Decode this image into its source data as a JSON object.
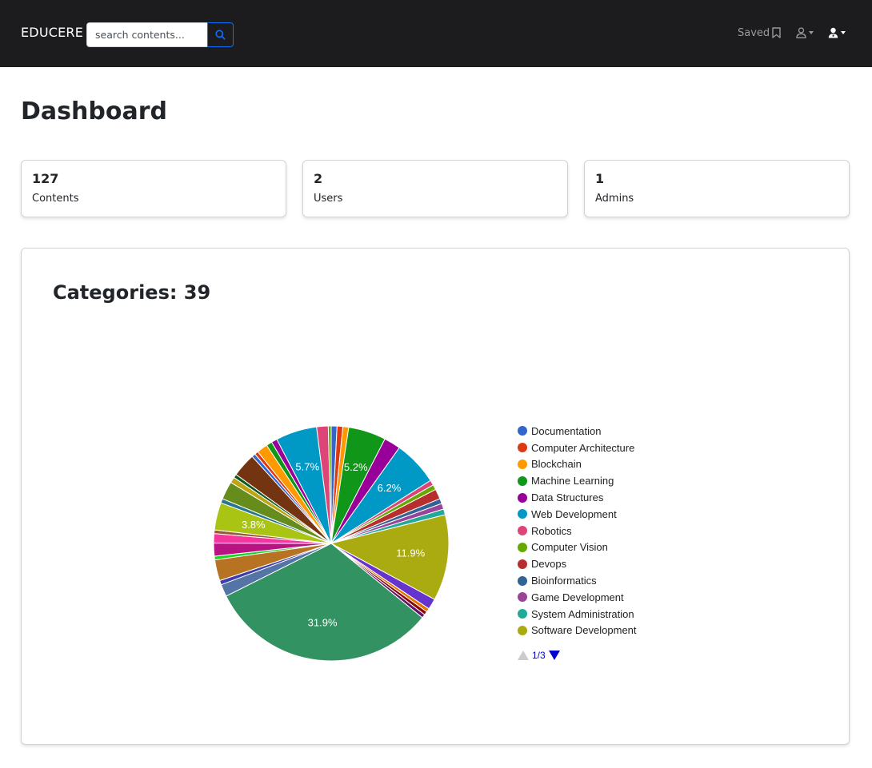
{
  "navbar": {
    "brand": "EDUCERE",
    "search": {
      "placeholder": "search contents..."
    },
    "saved_label": "Saved"
  },
  "page_title": "Dashboard",
  "stats": [
    {
      "value": "127",
      "label": "Contents"
    },
    {
      "value": "2",
      "label": "Users"
    },
    {
      "value": "1",
      "label": "Admins"
    }
  ],
  "chart_title": "Categories: 39",
  "legend_pager": {
    "text": "1/3"
  },
  "colors": {
    "navbar_bg": "#1c1c1e",
    "search_accent": "#0d6efd",
    "pager_link": "#0000cc"
  },
  "chart_data": {
    "type": "pie",
    "title": "Categories: 39",
    "legend_position": "right",
    "legend_page": "1/3",
    "legend": [
      {
        "name": "Documentation",
        "color": "#3366cc"
      },
      {
        "name": "Computer Architecture",
        "color": "#dc3912"
      },
      {
        "name": "Blockchain",
        "color": "#ff9900"
      },
      {
        "name": "Machine Learning",
        "color": "#109618"
      },
      {
        "name": "Data Structures",
        "color": "#990099"
      },
      {
        "name": "Web Development",
        "color": "#0099c6"
      },
      {
        "name": "Robotics",
        "color": "#dd4477"
      },
      {
        "name": "Computer Vision",
        "color": "#66aa00"
      },
      {
        "name": "Devops",
        "color": "#b82e2e"
      },
      {
        "name": "Bioinformatics",
        "color": "#316395"
      },
      {
        "name": "Game Development",
        "color": "#994499"
      },
      {
        "name": "System Administration",
        "color": "#22aa99"
      },
      {
        "name": "Software Development",
        "color": "#aaaa11"
      }
    ],
    "slices": [
      {
        "value": 0.8,
        "color": "#3366cc"
      },
      {
        "value": 0.8,
        "color": "#dc3912"
      },
      {
        "value": 0.8,
        "color": "#ff9900"
      },
      {
        "value": 5.2,
        "color": "#109618",
        "label": "5.2%"
      },
      {
        "value": 2.3,
        "color": "#990099"
      },
      {
        "value": 6.2,
        "color": "#0099c6",
        "label": "6.2%"
      },
      {
        "value": 0.7,
        "color": "#dd4477"
      },
      {
        "value": 0.7,
        "color": "#66aa00"
      },
      {
        "value": 1.4,
        "color": "#b82e2e"
      },
      {
        "value": 0.7,
        "color": "#316395"
      },
      {
        "value": 0.8,
        "color": "#994499"
      },
      {
        "value": 0.8,
        "color": "#22aa99"
      },
      {
        "value": 11.9,
        "color": "#aaaa11",
        "label": "11.9%"
      },
      {
        "value": 1.5,
        "color": "#6633cc"
      },
      {
        "value": 0.5,
        "color": "#e67300"
      },
      {
        "value": 0.5,
        "color": "#8b0707"
      },
      {
        "value": 0.5,
        "color": "#651067"
      },
      {
        "value": 31.9,
        "color": "#329262",
        "label": "31.9%"
      },
      {
        "value": 1.7,
        "color": "#5574a6"
      },
      {
        "value": 0.6,
        "color": "#3b3eac"
      },
      {
        "value": 2.9,
        "color": "#b77322"
      },
      {
        "value": 0.5,
        "color": "#16d620"
      },
      {
        "value": 1.8,
        "color": "#b91383"
      },
      {
        "value": 1.3,
        "color": "#f4359e"
      },
      {
        "value": 0.5,
        "color": "#9c5935"
      },
      {
        "value": 3.8,
        "color": "#a9c413",
        "label": "3.8%"
      },
      {
        "value": 0.6,
        "color": "#2a778d"
      },
      {
        "value": 2.5,
        "color": "#668d1c"
      },
      {
        "value": 0.8,
        "color": "#bea413"
      },
      {
        "value": 0.5,
        "color": "#0c5922"
      },
      {
        "value": 3.3,
        "color": "#743411"
      },
      {
        "value": 0.5,
        "color": "#3366cc"
      },
      {
        "value": 0.5,
        "color": "#dc3912"
      },
      {
        "value": 1.5,
        "color": "#ff9900"
      },
      {
        "value": 0.8,
        "color": "#109618"
      },
      {
        "value": 0.8,
        "color": "#990099"
      },
      {
        "value": 5.7,
        "color": "#0099c6",
        "label": "5.7%"
      },
      {
        "value": 1.6,
        "color": "#dd4477"
      },
      {
        "value": 0.4,
        "color": "#66aa00"
      }
    ]
  }
}
